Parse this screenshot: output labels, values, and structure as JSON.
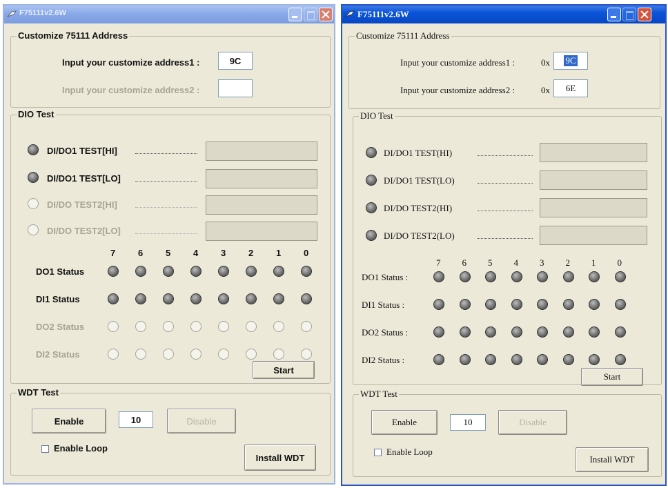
{
  "left": {
    "title": "F75111v2.6W",
    "customize": {
      "legend": "Customize 75111 Address",
      "label1": "Input your customize address1 :",
      "value1": "9C",
      "label2": "Input your customize address2 :",
      "value2": ""
    },
    "dio": {
      "legend": "DIO Test",
      "tests": [
        "DI/DO1 TEST[HI]",
        "DI/DO1 TEST[LO]",
        "DI/DO TEST2[HI]",
        "DI/DO TEST2[LO]"
      ],
      "bits": [
        "7",
        "6",
        "5",
        "4",
        "3",
        "2",
        "1",
        "0"
      ],
      "rows": [
        "DO1 Status",
        "DI1 Status",
        "DO2 Status",
        "DI2 Status"
      ],
      "start": "Start"
    },
    "wdt": {
      "legend": "WDT Test",
      "enable": "Enable",
      "value": "10",
      "disable": "Disable",
      "loop": "Enable Loop",
      "install": "Install WDT"
    }
  },
  "right": {
    "title": "F75111v2.6W",
    "customize": {
      "legend": "Customize 75111 Address",
      "label1": "Input your customize address1 :",
      "prefix": "0x",
      "value1": "9C",
      "label2": "Input your customize address2 :",
      "value2": "6E"
    },
    "dio": {
      "legend": "DIO Test",
      "tests": [
        "DI/DO1 TEST(HI)",
        "DI/DO1 TEST(LO)",
        "DI/DO TEST2(HI)",
        "DI/DO TEST2(LO)"
      ],
      "bits": [
        "7",
        "6",
        "5",
        "4",
        "3",
        "2",
        "1",
        "0"
      ],
      "rows": [
        "DO1 Status :",
        "DI1 Status :",
        "DO2 Status :",
        "DI2 Status :"
      ],
      "start": "Start"
    },
    "wdt": {
      "legend": "WDT Test",
      "enable": "Enable",
      "value": "10",
      "disable": "Disable",
      "loop": "Enable Loop",
      "install": "Install WDT"
    }
  }
}
